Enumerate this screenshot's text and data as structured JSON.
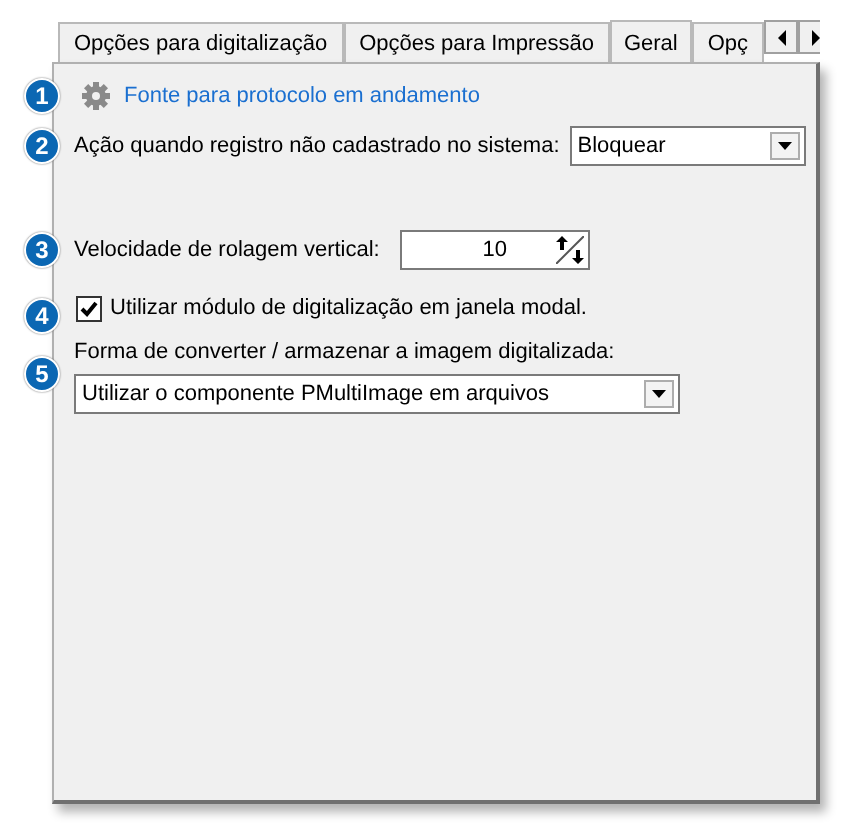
{
  "tabs": [
    {
      "label": "Opções para digitalização",
      "selected": false
    },
    {
      "label": "Opções para Impressão",
      "selected": false
    },
    {
      "label": "Geral",
      "selected": true
    },
    {
      "label": "Opç",
      "selected": false
    }
  ],
  "settings": [
    {
      "badge": "1",
      "kind": "link",
      "label": "Fonte para protocolo em andamento"
    },
    {
      "badge": "2",
      "kind": "select",
      "label": "Ação quando registro não cadastrado no sistema:",
      "value": "Bloquear"
    },
    {
      "badge": "3",
      "kind": "spin",
      "label": "Velocidade de rolagem vertical:",
      "value": "10"
    },
    {
      "badge": "4",
      "kind": "checkbox",
      "label": "Utilizar módulo de digitalização em janela modal.",
      "checked": true
    },
    {
      "badge": "5",
      "kind": "select_below",
      "label": "Forma de converter / armazenar a imagem digitalizada:",
      "value": "Utilizar o componente PMultiImage em arquivos"
    }
  ]
}
